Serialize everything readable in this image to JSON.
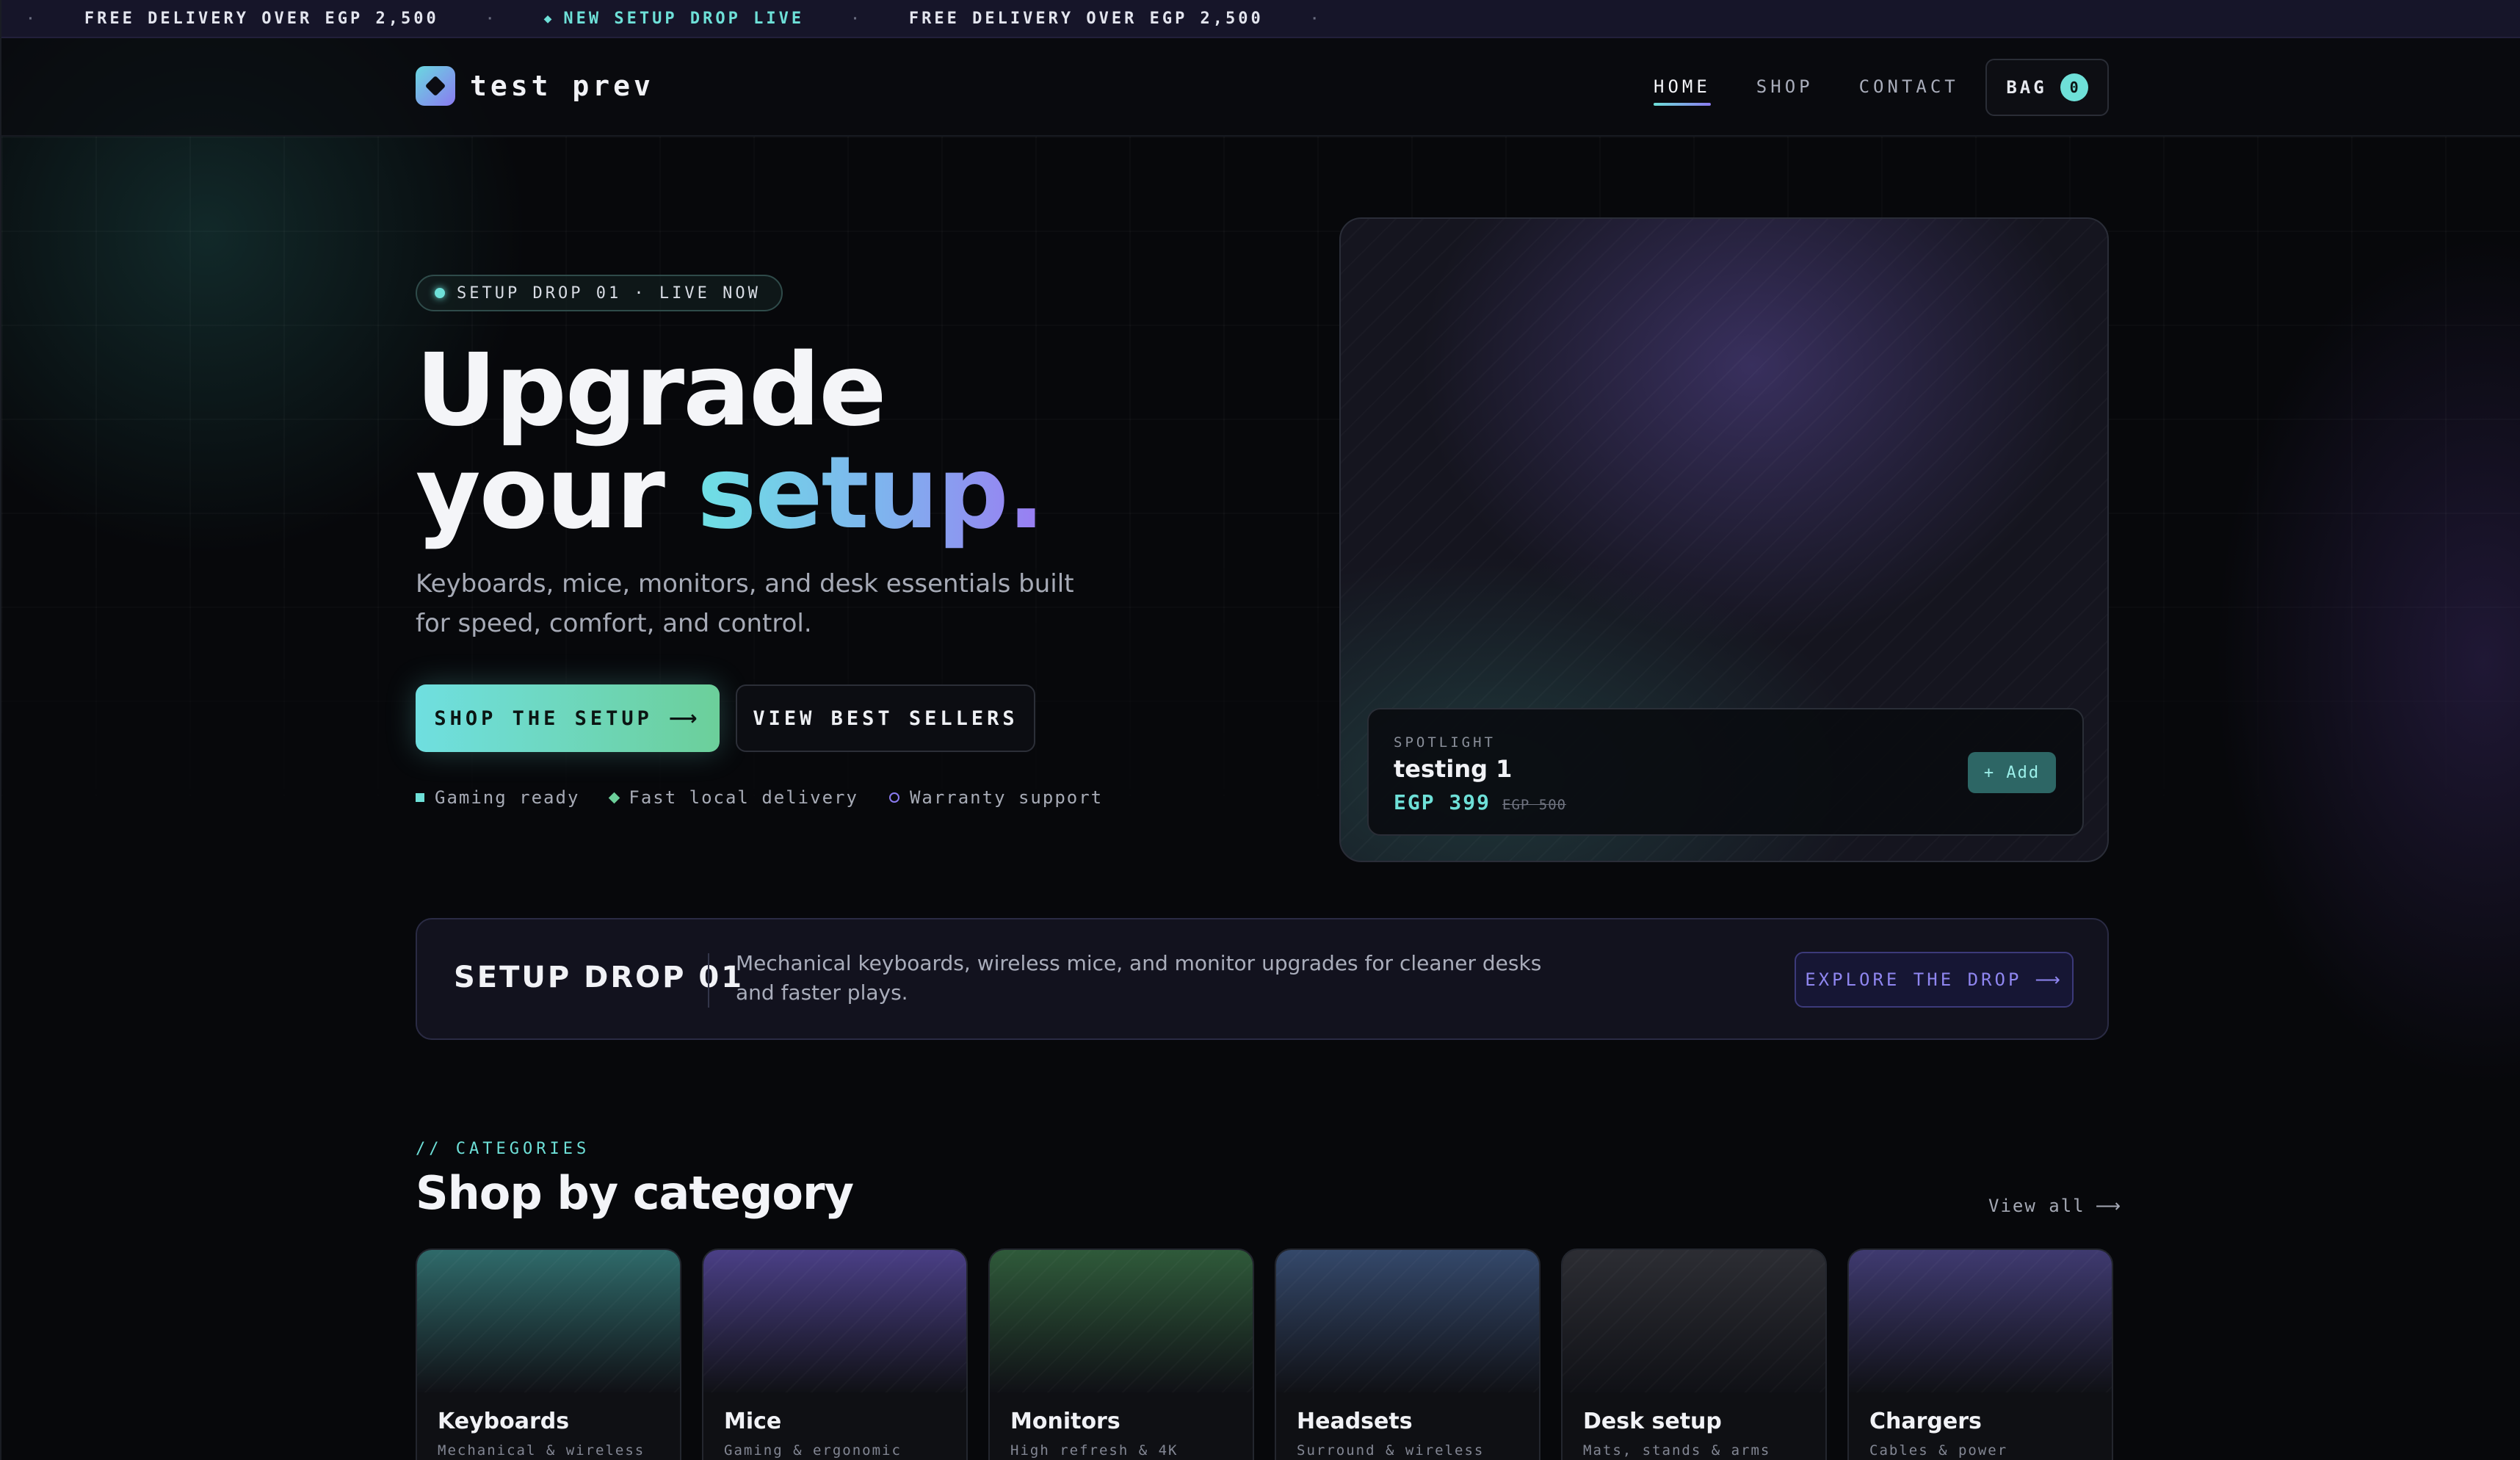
{
  "announcement": {
    "left_dot": "·",
    "items": [
      {
        "text": "FREE DELIVERY OVER EGP 2,500",
        "highlight": false
      },
      {
        "text": "NEW SETUP DROP LIVE",
        "highlight": true
      },
      {
        "text": "FREE DELIVERY OVER EGP 2,500",
        "highlight": false
      }
    ],
    "separator": "·"
  },
  "brand": {
    "name": "test prev"
  },
  "nav": {
    "links": [
      {
        "label": "HOME",
        "active": true
      },
      {
        "label": "SHOP",
        "active": false
      },
      {
        "label": "CONTACT",
        "active": false
      }
    ],
    "bag_label": "BAG",
    "bag_count": "0"
  },
  "hero": {
    "pill": "SETUP DROP 01 · LIVE NOW",
    "title_line1": "Upgrade",
    "title_line2_prefix": "your ",
    "title_line2_accent": "setup.",
    "subtitle": "Keyboards, mice, monitors, and desk essentials built for speed, comfort, and control.",
    "primary_cta": "SHOP THE SETUP",
    "secondary_cta": "VIEW BEST SELLERS",
    "perks": [
      "Gaming ready",
      "Fast local delivery",
      "Warranty support"
    ]
  },
  "spotlight": {
    "label": "SPOTLIGHT",
    "product_name": "testing 1",
    "price": "EGP 399",
    "old_price": "EGP 500",
    "add_label": "+ Add"
  },
  "drop_banner": {
    "title": "SETUP DROP 01",
    "description": "Mechanical keyboards, wireless mice, and monitor upgrades for cleaner desks and faster plays.",
    "cta": "EXPLORE THE DROP"
  },
  "categories": {
    "eyebrow": "// CATEGORIES",
    "title": "Shop by category",
    "view_all": "View all",
    "items": [
      {
        "name": "Keyboards",
        "sub": "Mechanical & wireless",
        "tint": "#2f6a6a"
      },
      {
        "name": "Mice",
        "sub": "Gaming & ergonomic",
        "tint": "#4a3f86"
      },
      {
        "name": "Monitors",
        "sub": "High refresh & 4K",
        "tint": "#2f5a3a"
      },
      {
        "name": "Headsets",
        "sub": "Surround & wireless",
        "tint": "#34486a"
      },
      {
        "name": "Desk setup",
        "sub": "Mats, stands & arms",
        "tint": "#2c2d33"
      },
      {
        "name": "Chargers",
        "sub": "Cables & power",
        "tint": "#3f3a70"
      }
    ]
  },
  "colors": {
    "accent_teal": "#6ee0d8",
    "accent_violet": "#8a7af0",
    "accent_green": "#6ccf9a",
    "background": "#07080b"
  }
}
